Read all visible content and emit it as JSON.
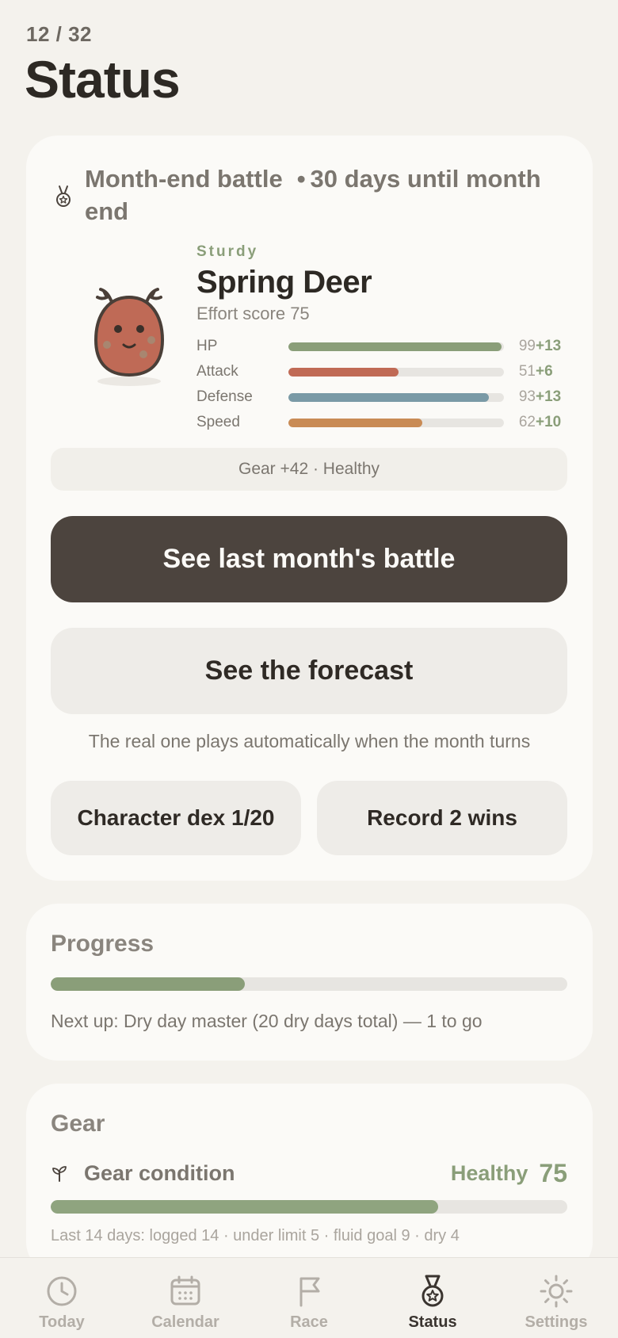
{
  "header": {
    "page_counter": "12 / 32",
    "title": "Status"
  },
  "battle": {
    "label": "Month-end battle",
    "separator": "•",
    "days_until": "30 days until month end",
    "character": {
      "type": "Sturdy",
      "name": "Spring Deer",
      "effort_score": "Effort score 75"
    },
    "stats": [
      {
        "label": "HP",
        "value": "99",
        "bonus": "+13",
        "fill": 0.99,
        "color": "#8a9e79"
      },
      {
        "label": "Attack",
        "value": "51",
        "bonus": "+6",
        "fill": 0.51,
        "color": "#c06a55"
      },
      {
        "label": "Defense",
        "value": "93",
        "bonus": "+13",
        "fill": 0.93,
        "color": "#7a9aa6"
      },
      {
        "label": "Speed",
        "value": "62",
        "bonus": "+10",
        "fill": 0.62,
        "color": "#c98b55"
      }
    ],
    "gear_summary": "Gear +42 · Healthy",
    "primary_button": "See last month's battle",
    "secondary_button": "See the forecast",
    "auto_note": "The real one plays automatically when the month turns",
    "dex_button": "Character dex 1/20",
    "record_button": "Record 2 wins"
  },
  "progress": {
    "title": "Progress",
    "fill": 0.375,
    "note": "Next up: Dry day master (20 dry days total) — 1 to go"
  },
  "gear": {
    "title": "Gear",
    "condition_label": "Gear condition",
    "condition_status": "Healthy",
    "condition_score": "75",
    "fill": 0.75,
    "note": "Last 14 days: logged 14 · under limit 5 · fluid goal 9 · dry 4"
  },
  "tabs": [
    {
      "label": "Today",
      "icon": "clock-icon",
      "active": false
    },
    {
      "label": "Calendar",
      "icon": "calendar-icon",
      "active": false
    },
    {
      "label": "Race",
      "icon": "flag-icon",
      "active": false
    },
    {
      "label": "Status",
      "icon": "medal-icon",
      "active": true
    },
    {
      "label": "Settings",
      "icon": "sun-icon",
      "active": false
    }
  ],
  "colors": {
    "accent_green": "#8a9e79",
    "primary_button": "#4c443e",
    "background": "#f4f2ed",
    "card": "#fbfaf7"
  }
}
